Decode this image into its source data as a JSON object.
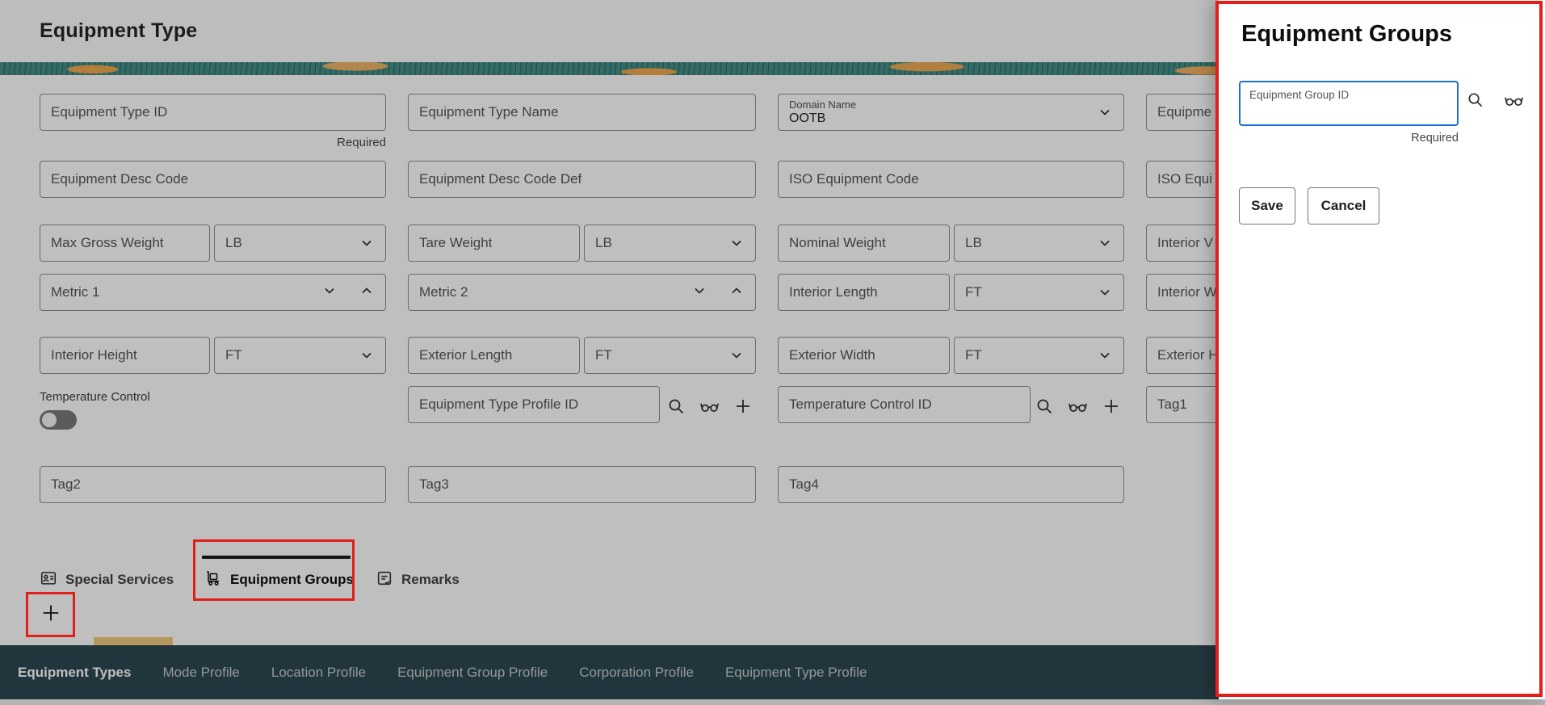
{
  "header": {
    "title": "Equipment Type"
  },
  "form": {
    "required_label": "Required",
    "equipment_type_id": "Equipment Type ID",
    "equipment_type_name": "Equipment Type Name",
    "domain_name": {
      "label": "Domain Name",
      "value": "OOTB"
    },
    "col4_row1": "Equipme",
    "equipment_desc_code": "Equipment Desc Code",
    "equipment_desc_code_def": "Equipment Desc Code Def",
    "iso_equipment_code": "ISO Equipment Code",
    "col4_row2": "ISO Equi",
    "max_gross_weight": "Max Gross Weight",
    "tare_weight": "Tare Weight",
    "nominal_weight": "Nominal Weight",
    "col4_row3": "Interior V",
    "weight_unit": "LB",
    "length_unit": "FT",
    "metric_1": "Metric 1",
    "metric_2": "Metric 2",
    "interior_length": "Interior Length",
    "col4_row4": "Interior W",
    "interior_height": "Interior Height",
    "exterior_length": "Exterior Length",
    "exterior_width": "Exterior Width",
    "col4_row5": "Exterior H",
    "temperature_control_label": "Temperature Control",
    "equipment_type_profile_id": "Equipment Type Profile ID",
    "temperature_control_id": "Temperature Control ID",
    "tag1": "Tag1",
    "tag2": "Tag2",
    "tag3": "Tag3",
    "tag4": "Tag4"
  },
  "tabs": {
    "special_services": "Special Services",
    "equipment_groups": "Equipment Groups",
    "remarks": "Remarks"
  },
  "nav": {
    "items": [
      {
        "label": "Equipment Types",
        "active": true
      },
      {
        "label": "Mode Profile",
        "active": false
      },
      {
        "label": "Location Profile",
        "active": false
      },
      {
        "label": "Equipment Group Profile",
        "active": false
      },
      {
        "label": "Corporation Profile",
        "active": false
      },
      {
        "label": "Equipment Type Profile",
        "active": false
      }
    ]
  },
  "panel": {
    "title": "Equipment Groups",
    "group_id_label": "Equipment Group ID",
    "required_label": "Required",
    "save_label": "Save",
    "cancel_label": "Cancel"
  },
  "icons": {
    "search": "magnifier",
    "glasses": "preview-eyeglasses",
    "plus": "add",
    "chevron_down": "expand",
    "chevron_up": "collapse",
    "id_card": "special-services-tab",
    "trolley": "equipment-groups-tab",
    "note": "remarks-tab"
  },
  "colors": {
    "annotation": "#e01f1a",
    "focus": "#1b6fd6",
    "banner-teal": "#459088",
    "banner-orange": "#f0a94f",
    "nav-bg": "#2c4750"
  }
}
